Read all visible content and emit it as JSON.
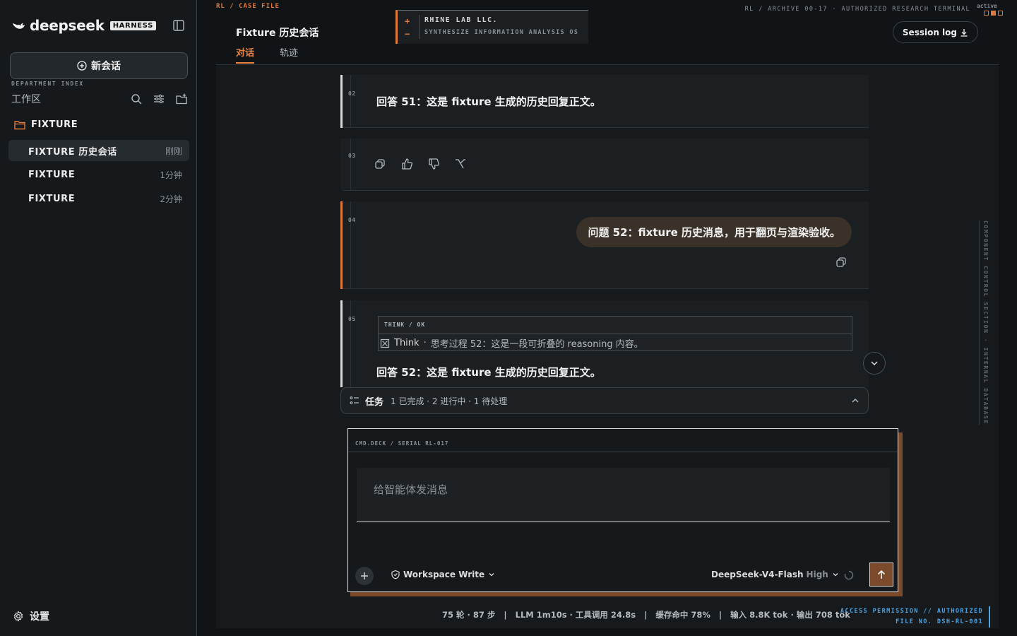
{
  "sidebar": {
    "logo_text": "deepseek",
    "logo_badge": "HARNESS",
    "new_chat_label": "新会话",
    "dept_index": "DEPARTMENT INDEX",
    "workspace_label": "工作区",
    "folder": "FIXTURE",
    "sessions": [
      {
        "title": "FIXTURE 历史会话",
        "time": "刚刚",
        "active": true
      },
      {
        "title": "FIXTURE",
        "time": "1分钟",
        "active": false
      },
      {
        "title": "FIXTURE",
        "time": "2分钟",
        "active": false
      }
    ],
    "settings_label": "设置"
  },
  "header": {
    "case_file": "RL / CASE FILE",
    "title": "Fixture 历史会话",
    "tabs": [
      {
        "label": "对话",
        "active": true
      },
      {
        "label": "轨迹",
        "active": false
      }
    ],
    "brand": {
      "plus": "+",
      "minus": "−",
      "name": "RHINE LAB LLC.",
      "sub": "SYNTHESIZE INFORMATION ANALYSIS OS"
    },
    "archive": "RL / ARCHIVE 00-17 · AUTHORIZED RESEARCH TERMINAL",
    "status": "active",
    "session_log": "Session log"
  },
  "messages": {
    "b02": {
      "num": "02",
      "text": "回答 51：这是 fixture 生成的历史回复正文。"
    },
    "b03": {
      "num": "03"
    },
    "b04": {
      "num": "04",
      "text": "问题 52：fixture 历史消息，用于翻页与渲染验收。"
    },
    "b05": {
      "num": "05",
      "think_head": "THINK / OK",
      "think_label": "Think",
      "think_sep": "·",
      "think_text": "思考过程 52：这是一段可折叠的 reasoning 内容。",
      "answer": "回答 52：这是 fixture 生成的历史回复正文。"
    }
  },
  "tasks": {
    "label": "任务",
    "stats": "1 已完成 · 2 进行中 · 1 待处理"
  },
  "composer": {
    "code": "CMD.DECK / SERIAL RL-017",
    "placeholder": "给智能体发消息",
    "mode": "Workspace Write",
    "model": "DeepSeek-V4-Flash",
    "effort": "High"
  },
  "footer": {
    "stats": "75 轮 · 87 步   |   LLM 1m10s · 工具调用 24.8s   |   缓存命中 78%   |   输入 8.8K tok · 输出 708 tok",
    "access_line1": "ACCESS PERMISSION // AUTHORIZED",
    "access_line2": "FILE NO. DSH-RL-001"
  },
  "vertical_label": "COMPONENT CONTROL SECTION · INTERNAL DATABASE",
  "colors": {
    "accent": "#e07a3c",
    "link": "#4fa3e0",
    "bg": "#111417"
  }
}
